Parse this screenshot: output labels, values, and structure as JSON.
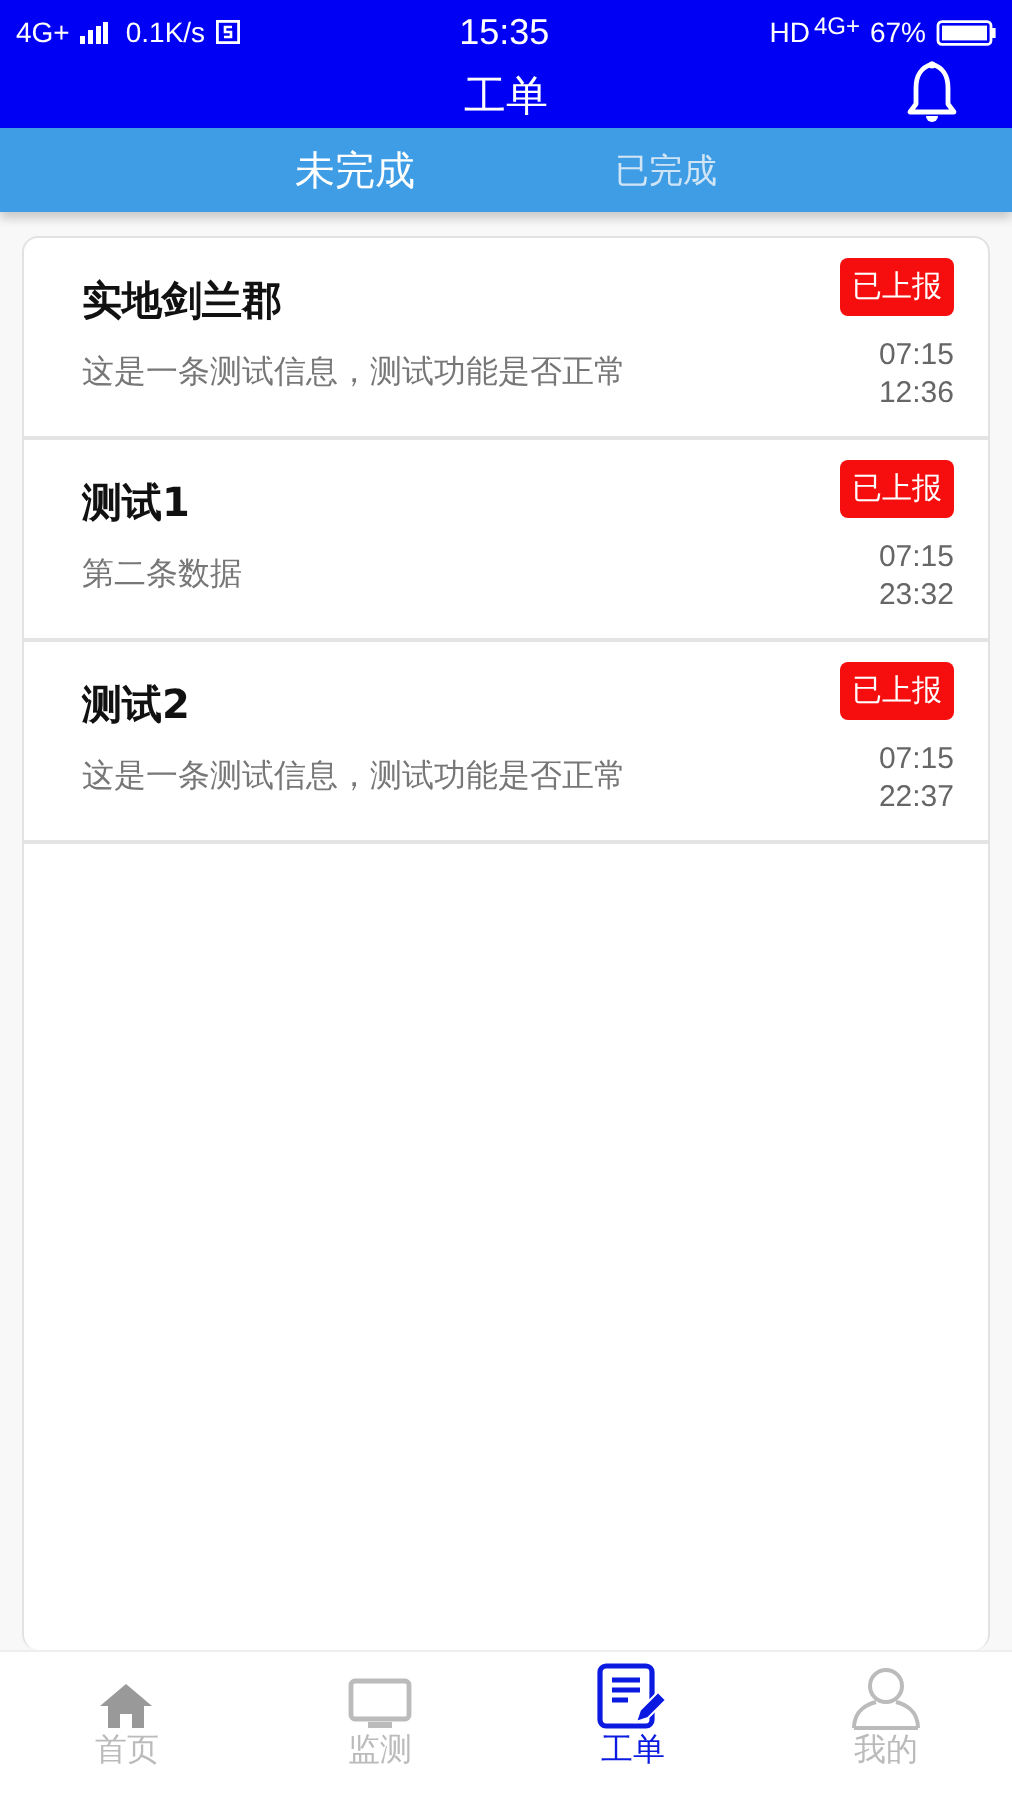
{
  "status_bar": {
    "network": "4G+",
    "speed": "0.1K/s",
    "time": "15:35",
    "hd": "HD",
    "network_right": "4G+",
    "battery": "67%"
  },
  "header": {
    "title": "工单"
  },
  "tabs": [
    {
      "label": "未完成",
      "selected": true
    },
    {
      "label": "已完成",
      "selected": false
    }
  ],
  "orders": [
    {
      "title": "实地剑兰郡",
      "description": "这是一条测试信息，测试功能是否正常",
      "status": "已上报",
      "date": "07:15",
      "time": "12:36"
    },
    {
      "title": "测试1",
      "description": "第二条数据",
      "status": "已上报",
      "date": "07:15",
      "time": "23:32"
    },
    {
      "title": "测试2",
      "description": "这是一条测试信息，测试功能是否正常",
      "status": "已上报",
      "date": "07:15",
      "time": "22:37"
    }
  ],
  "bottom_nav": [
    {
      "label": "首页",
      "selected": false
    },
    {
      "label": "监测",
      "selected": false
    },
    {
      "label": "工单",
      "selected": true
    },
    {
      "label": "我的",
      "selected": false
    }
  ]
}
